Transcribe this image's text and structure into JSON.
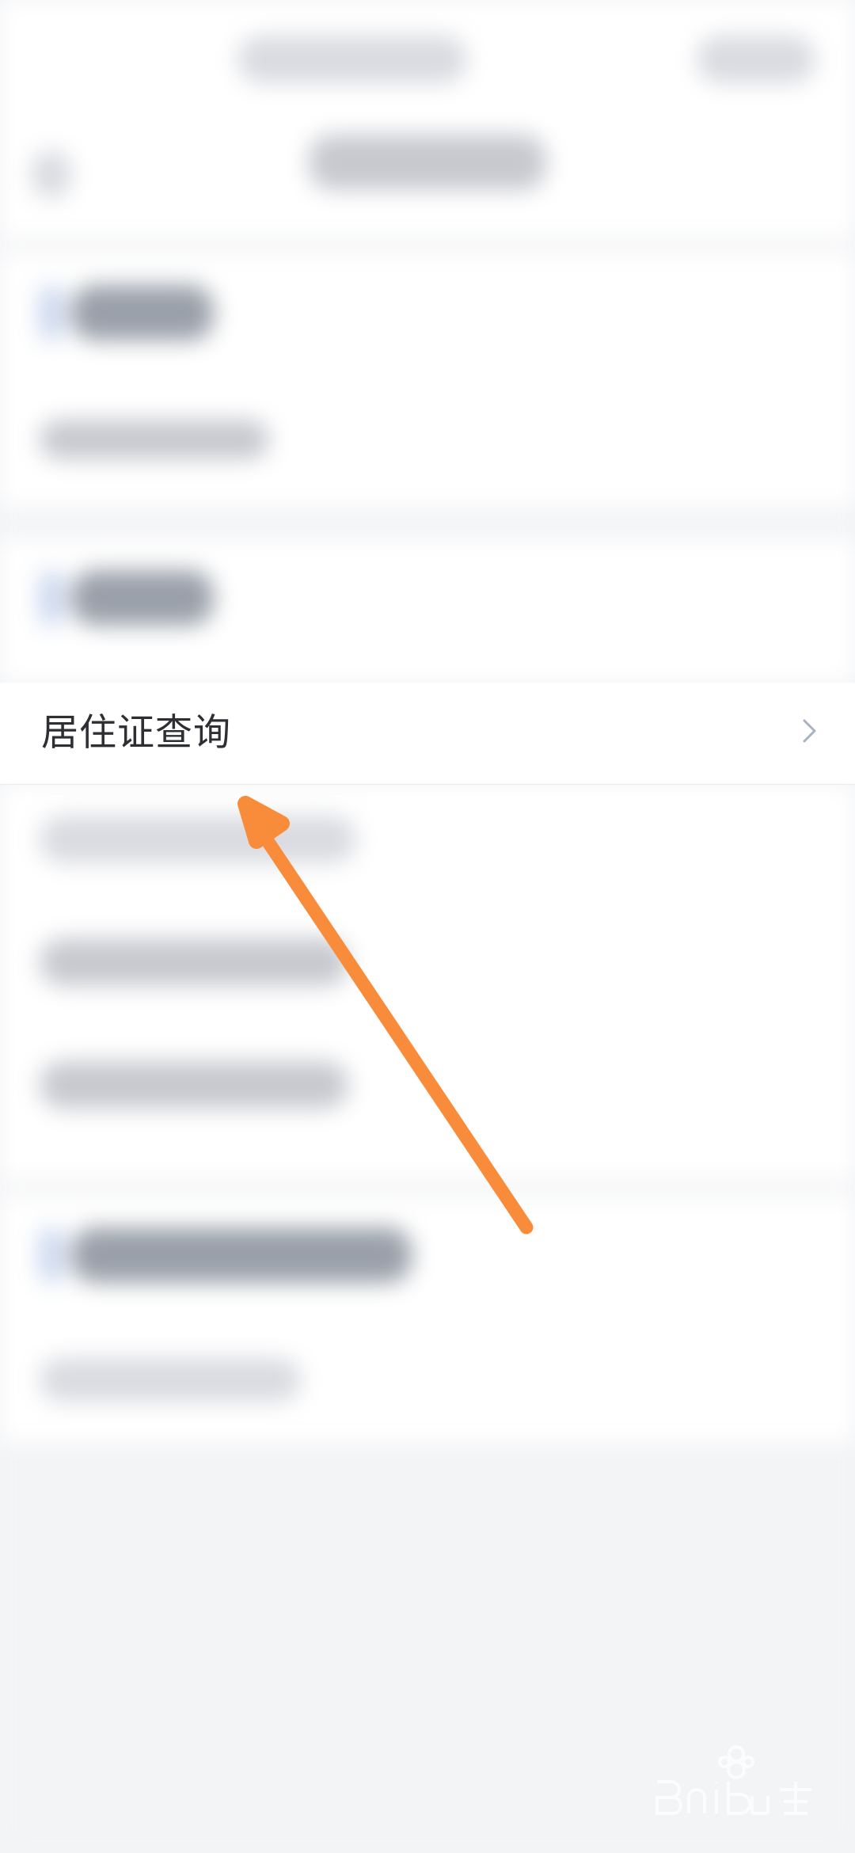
{
  "list": {
    "focus_item_label": "居住证查询"
  },
  "colors": {
    "arrow": "#f98c3a",
    "chevron": "#a9b1c4"
  },
  "icons": {
    "chevron": "chevron-right-icon",
    "annotation": "arrow-annotation-icon",
    "watermark": "baidu-jingyan-watermark"
  }
}
